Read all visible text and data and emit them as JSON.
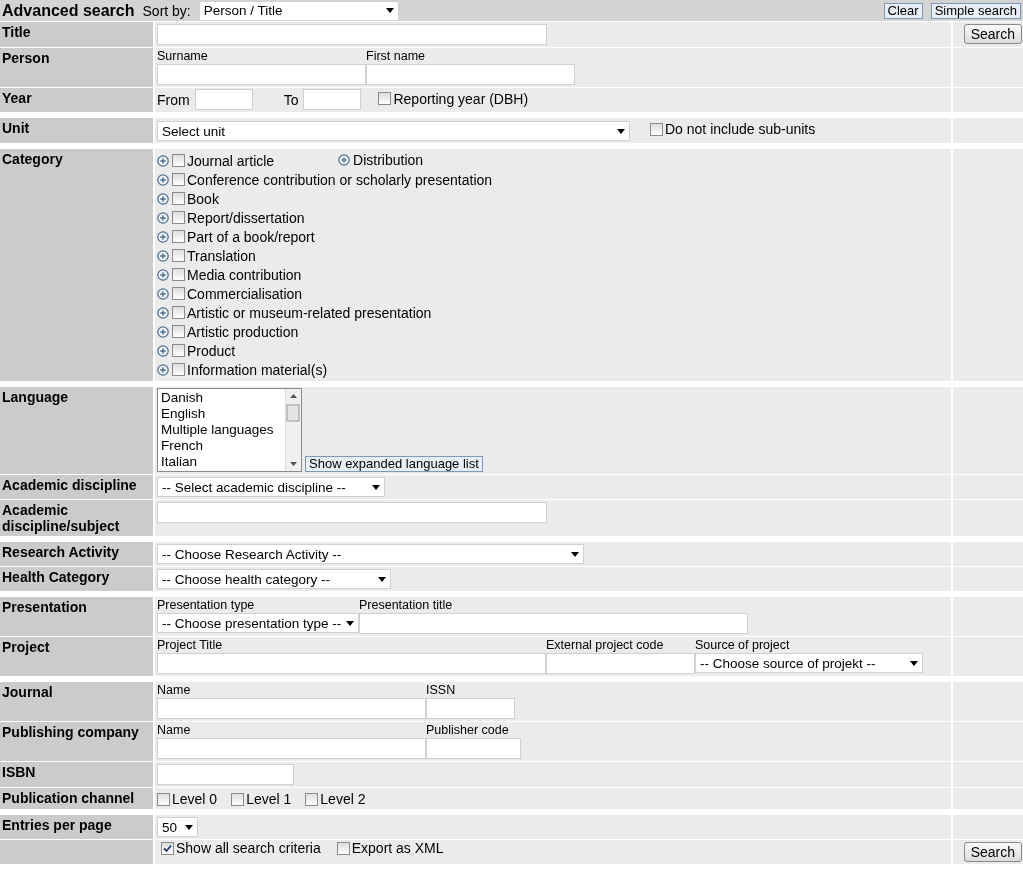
{
  "header": {
    "title": "Advanced search",
    "sort_label": "Sort by:",
    "sort_value": "Person / Title",
    "buttons": [
      "Clear",
      "Simple search"
    ]
  },
  "groups": [
    [
      {
        "kind": "title",
        "label": "Title",
        "button": "Search"
      },
      {
        "kind": "person",
        "label": "Person",
        "fields": [
          {
            "label": "Surname",
            "kind": "text"
          },
          {
            "label": "First name",
            "kind": "text"
          }
        ]
      },
      {
        "kind": "year",
        "label": "Year",
        "from": "From",
        "to": "To",
        "check": {
          "label": "Reporting year (DBH)",
          "checked": false
        }
      }
    ],
    [
      {
        "kind": "unit",
        "label": "Unit",
        "select": "Select unit",
        "check": {
          "label": "Do not include sub-units",
          "checked": false
        }
      }
    ],
    [
      {
        "kind": "category",
        "label": "Category",
        "items": [
          {
            "label": "Journal article",
            "checked": false
          },
          {
            "label": "Conference contribution or scholarly presentation",
            "checked": false
          },
          {
            "label": "Book",
            "checked": false
          },
          {
            "label": "Report/dissertation",
            "checked": false
          },
          {
            "label": "Part of a book/report",
            "checked": false
          },
          {
            "label": "Translation",
            "checked": false
          },
          {
            "label": "Media contribution",
            "checked": false
          },
          {
            "label": "Commercialisation",
            "checked": false
          },
          {
            "label": "Artistic or museum-related presentation",
            "checked": false
          },
          {
            "label": "Artistic production",
            "checked": false
          },
          {
            "label": "Product",
            "checked": false
          },
          {
            "label": "Information material(s)",
            "checked": false
          }
        ],
        "extra": "Distribution"
      }
    ],
    [
      {
        "kind": "language",
        "label": "Language",
        "options": [
          "Danish",
          "English",
          "Multiple languages",
          "French",
          "Italian"
        ],
        "expand_button": "Show expanded language list"
      },
      {
        "kind": "discipline",
        "label": "Academic discipline",
        "select": "-- Select academic discipline --"
      },
      {
        "kind": "subject",
        "label": "Academic discipline/subject"
      }
    ],
    [
      {
        "kind": "research",
        "label": "Research Activity",
        "select": "-- Choose Research Activity --"
      },
      {
        "kind": "health",
        "label": "Health Category",
        "select": "-- Choose health category --"
      }
    ],
    [
      {
        "kind": "presentation",
        "label": "Presentation",
        "fields": [
          {
            "label": "Presentation type",
            "kind": "select",
            "value": "-- Choose presentation type --"
          },
          {
            "label": "Presentation title",
            "kind": "text"
          }
        ]
      },
      {
        "kind": "project",
        "label": "Project",
        "fields": [
          {
            "label": "Project Title",
            "kind": "text"
          },
          {
            "label": "External project code",
            "kind": "text"
          },
          {
            "label": "Source of project",
            "kind": "select",
            "value": "-- Choose source of projekt --"
          }
        ]
      }
    ],
    [
      {
        "kind": "journal",
        "label": "Journal",
        "fields": [
          {
            "label": "Name",
            "kind": "text"
          },
          {
            "label": "ISSN",
            "kind": "text"
          }
        ]
      },
      {
        "kind": "publisher",
        "label": "Publishing company",
        "fields": [
          {
            "label": "Name",
            "kind": "text"
          },
          {
            "label": "Publisher code",
            "kind": "text"
          }
        ]
      },
      {
        "kind": "isbn",
        "label": "ISBN"
      },
      {
        "kind": "channel",
        "label": "Publication channel",
        "checks": [
          {
            "label": "Level 0",
            "checked": false
          },
          {
            "label": "Level 1",
            "checked": false
          },
          {
            "label": "Level 2",
            "checked": false
          }
        ]
      }
    ],
    [
      {
        "kind": "entries",
        "label": "Entries per page",
        "select": "50"
      },
      {
        "kind": "options",
        "checks": [
          {
            "label": "Show all search criteria",
            "checked": true
          },
          {
            "label": "Export as XML",
            "checked": false
          }
        ],
        "button": "Search"
      }
    ]
  ]
}
